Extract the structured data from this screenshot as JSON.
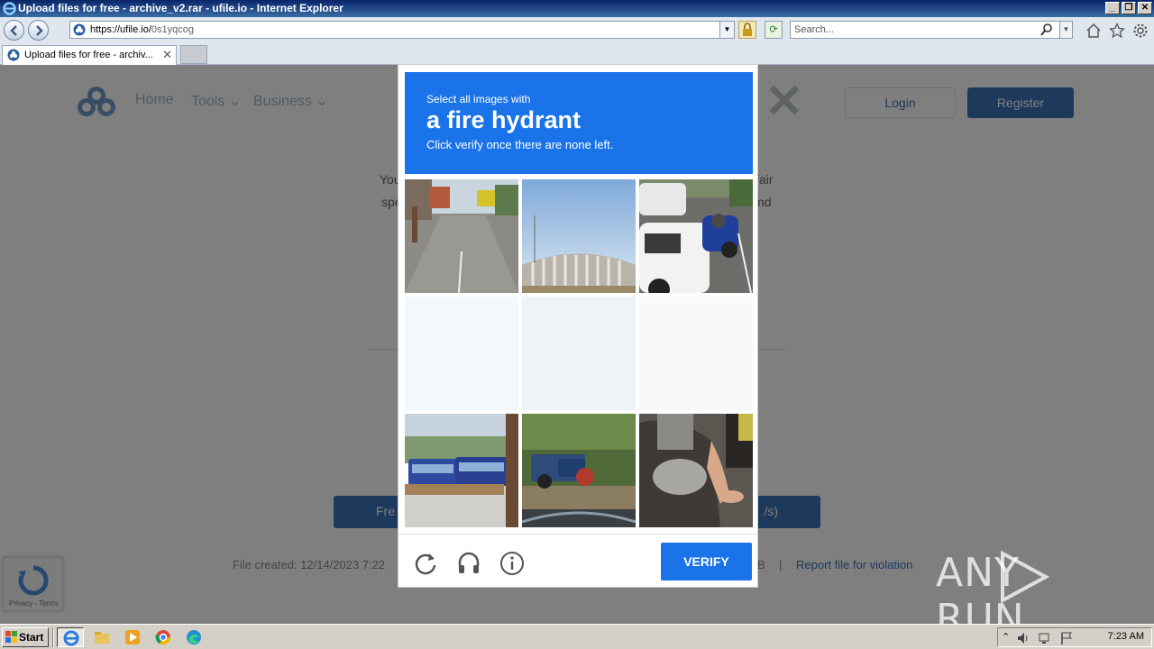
{
  "window": {
    "title": "Upload files for free - archive_v2.rar - ufile.io - Internet Explorer",
    "controls": [
      "_",
      "❐",
      "✕"
    ]
  },
  "address_bar": {
    "url_host": "https://ufile.io/",
    "url_path": "0s1yqcog",
    "search_placeholder": "Search..."
  },
  "tab": {
    "label": "Upload files for free - archiv...",
    "close": "✕"
  },
  "site": {
    "nav": [
      "Home",
      "Tools",
      "Business"
    ],
    "login": "Login",
    "register": "Register",
    "modal_text_1_start": "You",
    "modal_text_1_end": "fair",
    "modal_text_2_start": "spe",
    "modal_text_2_end": "nd",
    "modal_close": "✕",
    "download_left": "Fre",
    "download_right": "/s)",
    "file_created": "File created: 12/14/2023 7:22",
    "file_size": "B",
    "separator": "|",
    "report": "Report file for violation",
    "recaptcha_badge": "Privacy - Terms"
  },
  "captcha": {
    "subtitle": "Select all images with",
    "object": "a fire hydrant",
    "instruction": "Click verify once there are none left.",
    "verify": "VERIFY",
    "tiles": [
      {
        "name": "street-bus-road",
        "faded": false
      },
      {
        "name": "overpass-sky",
        "faded": false
      },
      {
        "name": "parked-cars-motorbike",
        "faded": false
      },
      {
        "name": "faded-tile-1",
        "faded": true
      },
      {
        "name": "faded-tile-2",
        "faded": true
      },
      {
        "name": "faded-tile-3",
        "faded": true
      },
      {
        "name": "blue-buses",
        "faded": false
      },
      {
        "name": "tractor-park",
        "faded": false
      },
      {
        "name": "motorbike-rider",
        "faded": false
      }
    ],
    "colors": {
      "accent": "#1a73e8"
    }
  },
  "watermark": {
    "text_left": "ANY",
    "text_right": "RUN"
  },
  "taskbar": {
    "start": "Start",
    "clock": "7:23 AM"
  }
}
